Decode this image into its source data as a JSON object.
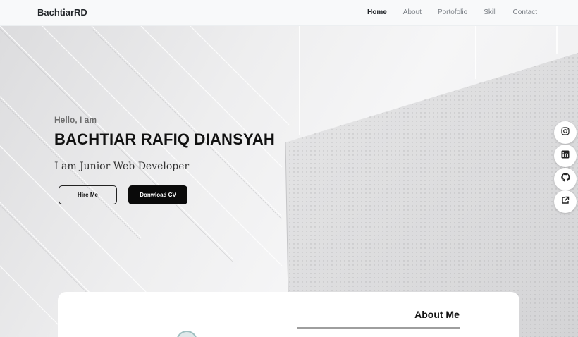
{
  "navbar": {
    "brand": "BachtiarRD",
    "links": [
      {
        "label": "Home",
        "active": true
      },
      {
        "label": "About",
        "active": false
      },
      {
        "label": "Portofolio",
        "active": false
      },
      {
        "label": "Skill",
        "active": false
      },
      {
        "label": "Contact",
        "active": false
      }
    ]
  },
  "hero": {
    "greeting": "Hello, I am",
    "name": "BACHTIAR RAFIQ DIANSYAH",
    "role": "I am Junior Web Developer",
    "hire_label": "Hire Me",
    "cv_label": "Donwload CV"
  },
  "social": [
    {
      "icon": "instagram-icon"
    },
    {
      "icon": "linkedin-icon"
    },
    {
      "icon": "github-icon"
    },
    {
      "icon": "external-link-icon"
    }
  ],
  "about": {
    "title": "About Me"
  },
  "colors": {
    "navbar_bg": "#f8f9fa",
    "text_dark": "#111111",
    "button_dark": "#0a0a0a",
    "nav_muted": "#7a7f85"
  }
}
